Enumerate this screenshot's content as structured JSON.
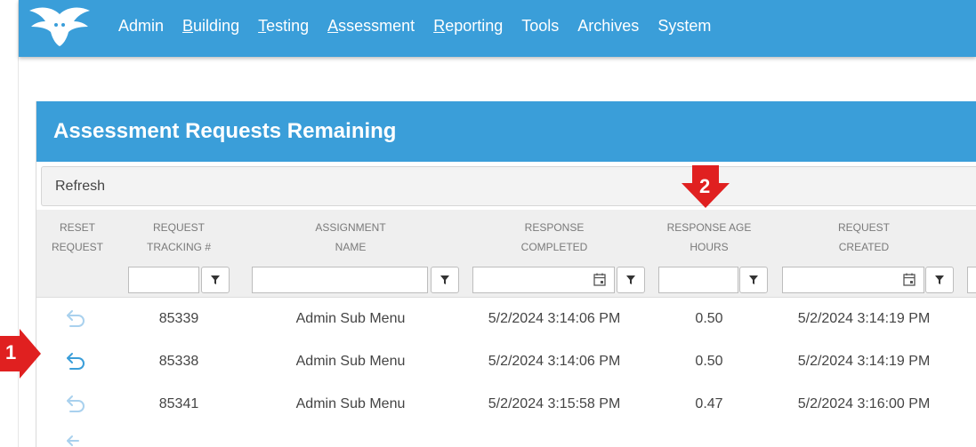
{
  "nav": {
    "items": [
      {
        "pre": "",
        "ul": "",
        "post": "Admin"
      },
      {
        "pre": "",
        "ul": "B",
        "post": "uilding"
      },
      {
        "pre": "",
        "ul": "T",
        "post": "esting"
      },
      {
        "pre": "",
        "ul": "A",
        "post": "ssessment"
      },
      {
        "pre": "",
        "ul": "R",
        "post": "eporting"
      },
      {
        "pre": "",
        "ul": "",
        "post": "Tools"
      },
      {
        "pre": "",
        "ul": "",
        "post": "Archives"
      },
      {
        "pre": "",
        "ul": "",
        "post": "System"
      }
    ]
  },
  "panel": {
    "title": "Assessment Requests Remaining",
    "refresh_label": "Refresh"
  },
  "columns": [
    {
      "l1": "RESET",
      "l2": "REQUEST"
    },
    {
      "l1": "REQUEST",
      "l2": "TRACKING #"
    },
    {
      "l1": "ASSIGNMENT",
      "l2": "NAME"
    },
    {
      "l1": "RESPONSE",
      "l2": "COMPLETED"
    },
    {
      "l1": "RESPONSE AGE",
      "l2": "HOURS"
    },
    {
      "l1": "REQUEST",
      "l2": "CREATED"
    }
  ],
  "rows": [
    {
      "tracking": "85339",
      "name": "Admin Sub Menu",
      "completed": "5/2/2024 3:14:06 PM",
      "age": "0.50",
      "created": "5/2/2024 3:14:19 PM"
    },
    {
      "tracking": "85338",
      "name": "Admin Sub Menu",
      "completed": "5/2/2024 3:14:06 PM",
      "age": "0.50",
      "created": "5/2/2024 3:14:19 PM"
    },
    {
      "tracking": "85341",
      "name": "Admin Sub Menu",
      "completed": "5/2/2024 3:15:58 PM",
      "age": "0.47",
      "created": "5/2/2024 3:16:00 PM"
    }
  ],
  "markers": {
    "one": "1",
    "two": "2"
  },
  "colors": {
    "brand": "#3a9ed9",
    "marker": "#e02020",
    "reset_icon": "#3a9ed9",
    "reset_icon_faded": "#a9d1ee"
  }
}
